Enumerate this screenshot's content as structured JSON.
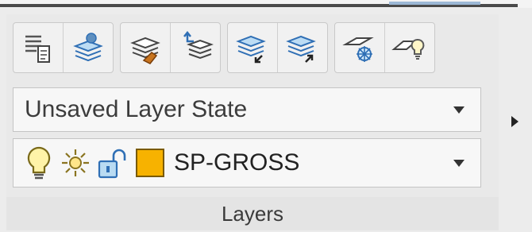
{
  "toolbar": {
    "groups": [
      {
        "buttons": [
          {
            "icon": "layer-properties-icon"
          },
          {
            "icon": "layer-state-manager-icon"
          }
        ]
      },
      {
        "buttons": [
          {
            "icon": "match-layer-icon"
          },
          {
            "icon": "previous-layer-icon"
          }
        ]
      },
      {
        "buttons": [
          {
            "icon": "layer-isolate-icon"
          },
          {
            "icon": "layer-unisolate-icon"
          }
        ]
      },
      {
        "buttons": [
          {
            "icon": "layer-freeze-icon"
          },
          {
            "icon": "layer-off-icon"
          }
        ]
      }
    ]
  },
  "layer_state": {
    "value": "Unsaved Layer State"
  },
  "current_layer": {
    "name": "SP-GROSS",
    "color": "#F7B200",
    "icons": [
      "lightbulb-icon",
      "sun-icon",
      "unlock-icon"
    ]
  },
  "panel": {
    "title": "Layers"
  },
  "colors": {
    "accent": "#2f6fb5",
    "swatch": "#F7B200"
  }
}
